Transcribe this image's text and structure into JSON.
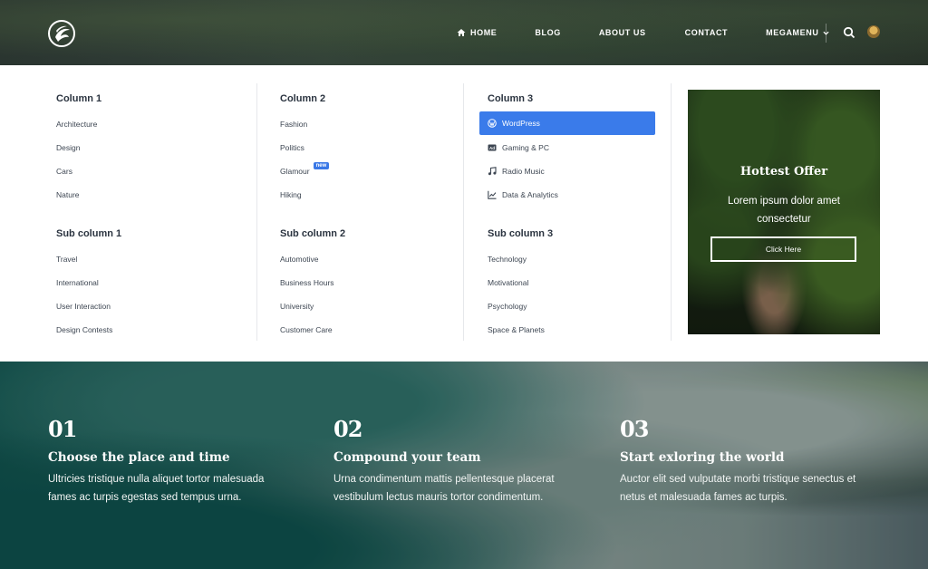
{
  "nav": {
    "home": "HOME",
    "blog": "BLOG",
    "about": "ABOUT US",
    "contact": "CONTACT",
    "megamenu": "MEGAMENU"
  },
  "mega": {
    "column1": {
      "heading": "Column 1",
      "links": [
        "Architecture",
        "Design",
        "Cars",
        "Nature"
      ],
      "sub_heading": "Sub column 1",
      "sub_links": [
        "Travel",
        "International",
        "User Interaction",
        "Design Contests"
      ]
    },
    "column2": {
      "heading": "Column 2",
      "links": [
        "Fashion",
        "Politics",
        "Glamour",
        "Hiking"
      ],
      "badge": "new",
      "sub_heading": "Sub column 2",
      "sub_links": [
        "Automotive",
        "Business Hours",
        "University",
        "Customer Care"
      ]
    },
    "column3": {
      "heading": "Column 3",
      "links": [
        "WordPress",
        "Gaming & PC",
        "Radio Music",
        "Data & Analytics"
      ],
      "link_icons": [
        "wordpress-icon",
        "ad-icon",
        "music-icon",
        "chart-icon"
      ],
      "sub_heading": "Sub column 3",
      "sub_links": [
        "Technology",
        "Motivational",
        "Psychology",
        "Space & Planets"
      ]
    },
    "offer": {
      "title": "Hottest Offer",
      "text": "Lorem ipsum dolor amet consectetur",
      "button": "Click Here"
    }
  },
  "features": [
    {
      "number": "01",
      "title": "Choose the place and time",
      "text": "Ultricies tristique nulla aliquet tortor malesuada fames ac turpis egestas sed tempus urna."
    },
    {
      "number": "02",
      "title": "Compound your team",
      "text": "Urna condimentum mattis pellentesque placerat vestibulum lectus mauris tortor condimentum."
    },
    {
      "number": "03",
      "title": "Start exloring the world",
      "text": "Auctor elit sed vulputate morbi tristique senectus et netus et malesuada fames ac turpis."
    }
  ],
  "colors": {
    "accent": "#3a7bea",
    "text_dark": "#2b3440",
    "text_body": "#3d4652"
  }
}
